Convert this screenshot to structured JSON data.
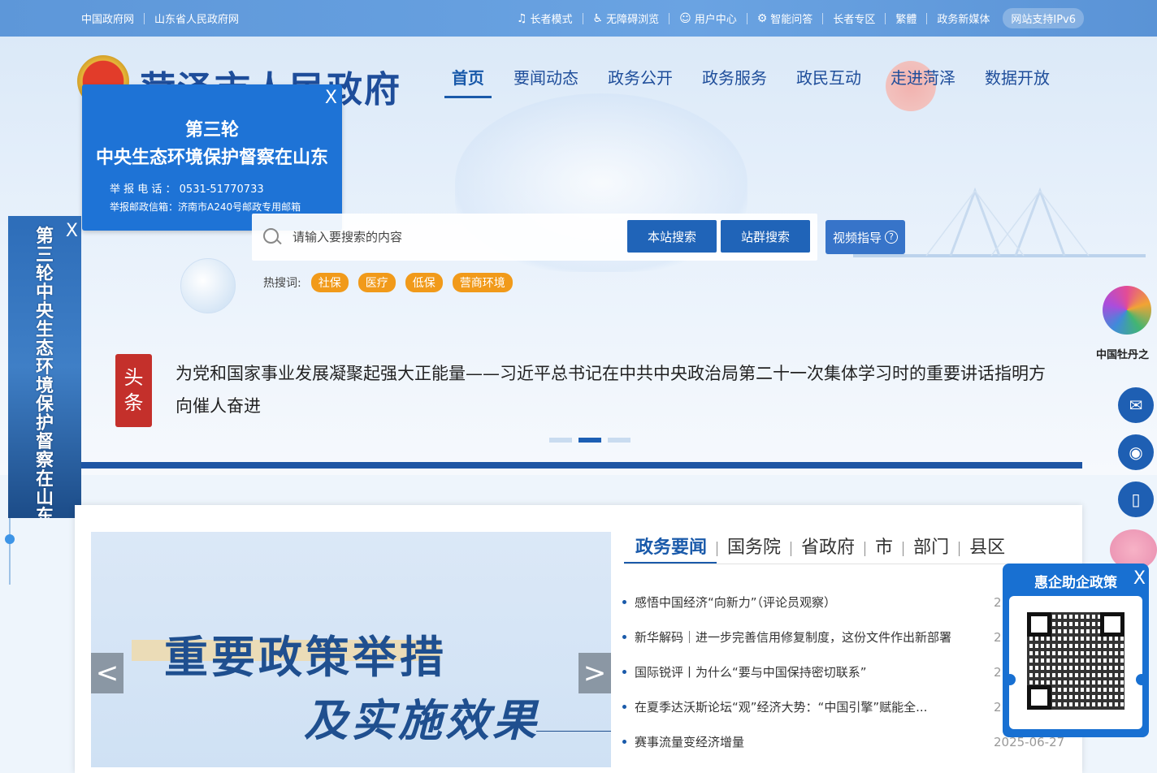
{
  "topbar": {
    "links_left": [
      "中国政府网",
      "山东省人民政府网"
    ],
    "links_right": [
      {
        "icon": "elderly-icon",
        "label": "长者模式"
      },
      {
        "icon": "accessibility-icon",
        "label": "无障碍浏览"
      },
      {
        "icon": "user-icon",
        "label": "用户中心"
      },
      {
        "icon": "robot-icon",
        "label": "智能问答"
      },
      {
        "icon": "",
        "label": "长者专区"
      },
      {
        "icon": "",
        "label": "繁體"
      },
      {
        "icon": "",
        "label": "政务新媒体"
      },
      {
        "icon": "",
        "label": "网站支持IPv6"
      }
    ]
  },
  "header": {
    "site_title": "菏泽市人民政府",
    "nav": [
      "首页",
      "要闻动态",
      "政务公开",
      "政务服务",
      "政民互动",
      "走进菏泽",
      "数据开放"
    ],
    "active_nav": "首页"
  },
  "popup_ad": {
    "close": "X",
    "line1": "第三轮",
    "line2": "中央生态环境保护督察在山东",
    "phone": "举 报 电 话 ： 0531-51770733",
    "mail": "举报邮政信箱：济南市A240号邮政专用邮箱"
  },
  "vertical_ad": {
    "close": "X",
    "text": "第三轮中央生态环境保护督察在山东"
  },
  "search": {
    "placeholder": "请输入要搜索的内容",
    "btn_site": "本站搜索",
    "btn_group": "站群搜索",
    "btn_video": "视频指导",
    "hot_label": "热搜词:",
    "hot_tags": [
      "社保",
      "医疗",
      "低保",
      "营商环境"
    ]
  },
  "headline": {
    "tag": "头条",
    "text": "为党和国家事业发展凝聚起强大正能量——习近平总书记在中共中央政治局第二十一次集体学习时的重要讲话指明方向催人奋进"
  },
  "banner": {
    "line1": "重要政策举措",
    "line2": "及实施效果",
    "prev": "<",
    "next": ">"
  },
  "news": {
    "tabs": [
      "政务要闻",
      "国务院",
      "省政府",
      "市",
      "部门",
      "县区"
    ],
    "active_tab": "政务要闻",
    "items": [
      {
        "title": "感悟中国经济“向新力”（评论员观察）",
        "date": "2"
      },
      {
        "title": "新华解码｜进一步完善信用修复制度，这份文件作出新部署",
        "date": "2"
      },
      {
        "title": "国际锐评丨为什么“要与中国保持密切联系”",
        "date": "2"
      },
      {
        "title": "在夏季达沃斯论坛“观”经济大势：“中国引擎”赋能全...",
        "date": "2"
      },
      {
        "title": "赛事流量变经济增量",
        "date": "2025-06-27"
      }
    ]
  },
  "sidebar": {
    "brand_text": "中国牡丹之",
    "buttons": [
      "wechat-icon",
      "weibo-icon",
      "mobile-icon"
    ]
  },
  "qr_ad": {
    "title": "惠企助企政策",
    "close": "X"
  }
}
